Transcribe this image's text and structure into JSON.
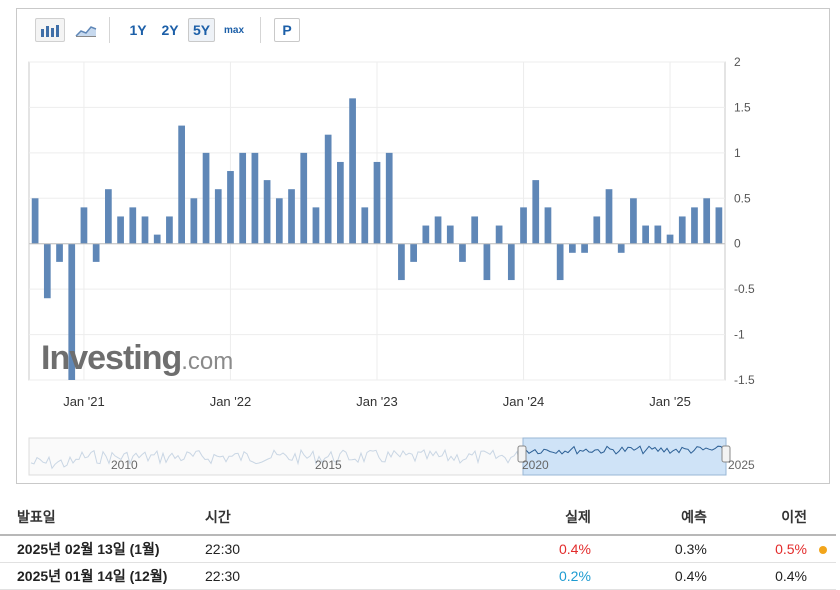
{
  "toolbar": {
    "ranges": [
      "1Y",
      "2Y",
      "5Y",
      "max"
    ],
    "active_range": "5Y",
    "p_label": "P",
    "icons": [
      "bar-chart-icon",
      "area-chart-icon"
    ]
  },
  "chart_data": {
    "type": "bar",
    "color": "#5f87b7",
    "x_ticks": [
      "Jan '21",
      "Jan '22",
      "Jan '23",
      "Jan '24",
      "Jan '25"
    ],
    "y_ticks": [
      "2",
      "1.5",
      "1",
      "0.5",
      "0",
      "-0.5",
      "-1",
      "-1.5"
    ],
    "ylim": [
      -1.5,
      2
    ],
    "grid": true,
    "values": [
      0.5,
      -0.6,
      -0.2,
      -1.5,
      0.4,
      -0.2,
      0.6,
      0.3,
      0.4,
      0.3,
      0.1,
      0.3,
      1.3,
      0.5,
      1.0,
      0.6,
      0.8,
      1.0,
      1.0,
      0.7,
      0.5,
      0.6,
      1.0,
      0.4,
      1.2,
      0.9,
      1.6,
      0.4,
      0.9,
      1.0,
      -0.4,
      -0.2,
      0.2,
      0.3,
      0.2,
      -0.2,
      0.3,
      -0.4,
      0.2,
      -0.4,
      0.4,
      0.7,
      0.4,
      -0.4,
      -0.1,
      -0.1,
      0.3,
      0.6,
      -0.1,
      0.5,
      0.2,
      0.2,
      0.1,
      0.3,
      0.4,
      0.5,
      0.4
    ],
    "navigator": {
      "labels": [
        "2010",
        "2015",
        "2020",
        "2025"
      ]
    }
  },
  "watermark": {
    "brand": "Investing",
    "suffix": ".com"
  },
  "table": {
    "headers": {
      "date": "발표일",
      "time": "시간",
      "actual": "실제",
      "forecast": "예측",
      "previous": "이전"
    },
    "rows": [
      {
        "date": "2025년 02월 13일 (1월)",
        "time": "22:30",
        "actual": "0.4%",
        "actual_color": "#e32b2b",
        "forecast": "0.3%",
        "previous": "0.5%",
        "previous_color": "#e32b2b",
        "marker": true
      },
      {
        "date": "2025년 01월 14일 (12월)",
        "time": "22:30",
        "actual": "0.2%",
        "actual_color": "#1d9bd1",
        "forecast": "0.4%",
        "previous": "0.4%",
        "previous_color": "#222222",
        "marker": false
      }
    ]
  }
}
